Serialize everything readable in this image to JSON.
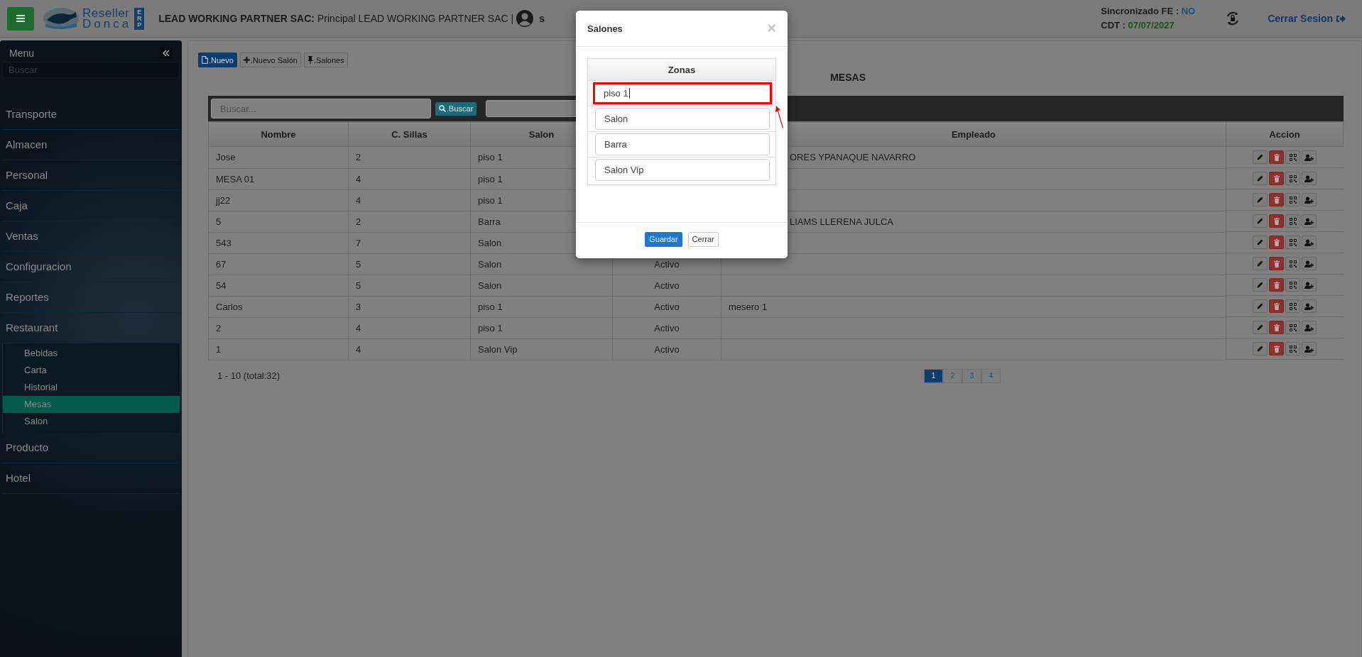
{
  "header": {
    "logo": {
      "line1": "Reseller",
      "line2": "Donca",
      "badge": "ERP"
    },
    "company_label": "LEAD WORKING PARTNER SAC:",
    "company_text": "Principal LEAD WORKING PARTNER SAC |",
    "user": "s",
    "sync_label": "Sincronizado FE :",
    "sync_value": "NO",
    "cdt_label": "CDT :",
    "cdt_value": "07/07/2027",
    "logout": "Cerrar Sesion"
  },
  "sidebar": {
    "title": "Menu",
    "search_placeholder": "Buscar",
    "items": [
      {
        "label": "Transporte"
      },
      {
        "label": "Almacen"
      },
      {
        "label": "Personal"
      },
      {
        "label": "Caja"
      },
      {
        "label": "Ventas"
      },
      {
        "label": "Configuracion"
      },
      {
        "label": "Reportes"
      },
      {
        "label": "Restaurant",
        "children": [
          {
            "label": "Bebidas",
            "selected": false
          },
          {
            "label": "Carta",
            "selected": false
          },
          {
            "label": "Historial",
            "selected": false
          },
          {
            "label": "Mesas",
            "selected": true
          },
          {
            "label": "Salon",
            "selected": false
          }
        ]
      },
      {
        "label": "Producto"
      },
      {
        "label": "Hotel"
      }
    ]
  },
  "toolbar": [
    {
      "label": ".Nuevo",
      "kind": "primary"
    },
    {
      "label": ".Nuevo Salón",
      "kind": "default"
    },
    {
      "label": ".Salones",
      "kind": "default"
    }
  ],
  "page_title": "MESAS",
  "search": {
    "placeholder": "Buscar...",
    "button": ".Buscar"
  },
  "table": {
    "columns": [
      "Nombre",
      "C. Sillas",
      "Salon",
      "Empleado",
      "Accion"
    ],
    "rows": [
      {
        "nombre": "Jose",
        "sillas": "2",
        "salon": "piso 1",
        "empleado": "ORES YPANAQUE NAVARRO",
        "empleado_clipped": true
      },
      {
        "nombre": "MESA 01",
        "sillas": "4",
        "salon": "piso 1"
      },
      {
        "nombre": "jj22",
        "sillas": "4",
        "salon": "piso 1"
      },
      {
        "nombre": "5",
        "sillas": "2",
        "salon": "Barra",
        "empleado": "LIAMS LLERENA JULCA",
        "empleado_clipped": true
      },
      {
        "nombre": "543",
        "sillas": "7",
        "salon": "Salon"
      },
      {
        "nombre": "67",
        "sillas": "5",
        "salon": "Salon",
        "estado": "Activo"
      },
      {
        "nombre": "54",
        "sillas": "5",
        "salon": "Salon",
        "estado": "Activo"
      },
      {
        "nombre": "Carlos",
        "sillas": "3",
        "salon": "piso 1",
        "estado": "Activo",
        "empleado": "mesero 1"
      },
      {
        "nombre": "2",
        "sillas": "4",
        "salon": "piso 1",
        "estado": "Activo"
      },
      {
        "nombre": "1",
        "sillas": "4",
        "salon": "Salon Vip",
        "estado": "Activo"
      }
    ]
  },
  "footer": {
    "range": "1 - 10 (total:32)",
    "pages": [
      {
        "label": "1",
        "selected": true
      },
      {
        "label": "2",
        "selected": false
      },
      {
        "label": "3",
        "selected": false
      },
      {
        "label": "4",
        "selected": false
      }
    ]
  },
  "modal": {
    "title": "Salones",
    "close": "×",
    "column": "Zonas",
    "zones": [
      {
        "value": "piso 1",
        "highlighted": true
      },
      {
        "value": "Salon",
        "highlighted": false
      },
      {
        "value": "Barra",
        "highlighted": false
      },
      {
        "value": "Salon Vip",
        "highlighted": false
      }
    ],
    "buttons": [
      {
        "label": "Guardar",
        "kind": "primary"
      },
      {
        "label": "Cerrar",
        "kind": "default"
      }
    ]
  }
}
